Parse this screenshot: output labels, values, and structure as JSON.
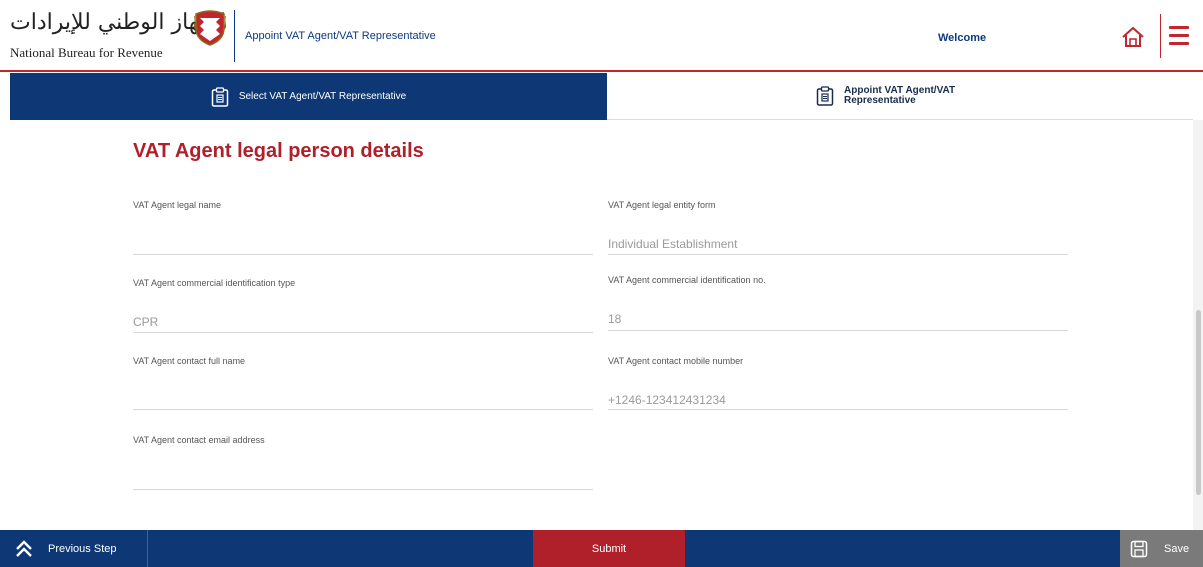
{
  "header": {
    "logo_arabic": "الجهاز الوطني للإيرادات",
    "logo_english": "National Bureau for Revenue",
    "page_title": "Appoint VAT Agent/VAT Representative",
    "welcome": "Welcome",
    "home_icon": "home-icon",
    "menu_icon": "hamburger-menu-icon"
  },
  "steps": [
    {
      "label": "Select VAT Agent/VAT Representative",
      "icon": "clipboard-icon",
      "active": true
    },
    {
      "label": "Appoint VAT Agent/VAT Representative",
      "icon": "clipboard-icon",
      "active": false
    }
  ],
  "form": {
    "section_title": "VAT Agent legal person details",
    "fields": {
      "legal_name": {
        "label": "VAT Agent legal name",
        "value": ""
      },
      "legal_entity_form": {
        "label": "VAT Agent legal entity form",
        "value": "Individual Establishment"
      },
      "commercial_id_type": {
        "label": "VAT Agent commercial identification type",
        "value": "CPR"
      },
      "commercial_id_no": {
        "label": "VAT Agent commercial identification no.",
        "value": "18"
      },
      "contact_full_name": {
        "label": "VAT Agent contact full name",
        "value": ""
      },
      "contact_mobile": {
        "label": "VAT Agent contact mobile number",
        "value": "+1246-123412431234"
      },
      "contact_email": {
        "label": "VAT Agent contact email address",
        "value": ""
      }
    }
  },
  "footer": {
    "previous_label": "Previous Step",
    "submit_label": "Submit",
    "save_label": "Save"
  },
  "colors": {
    "navy": "#0e3775",
    "red": "#b0202a",
    "gray": "#7a7a7a"
  }
}
